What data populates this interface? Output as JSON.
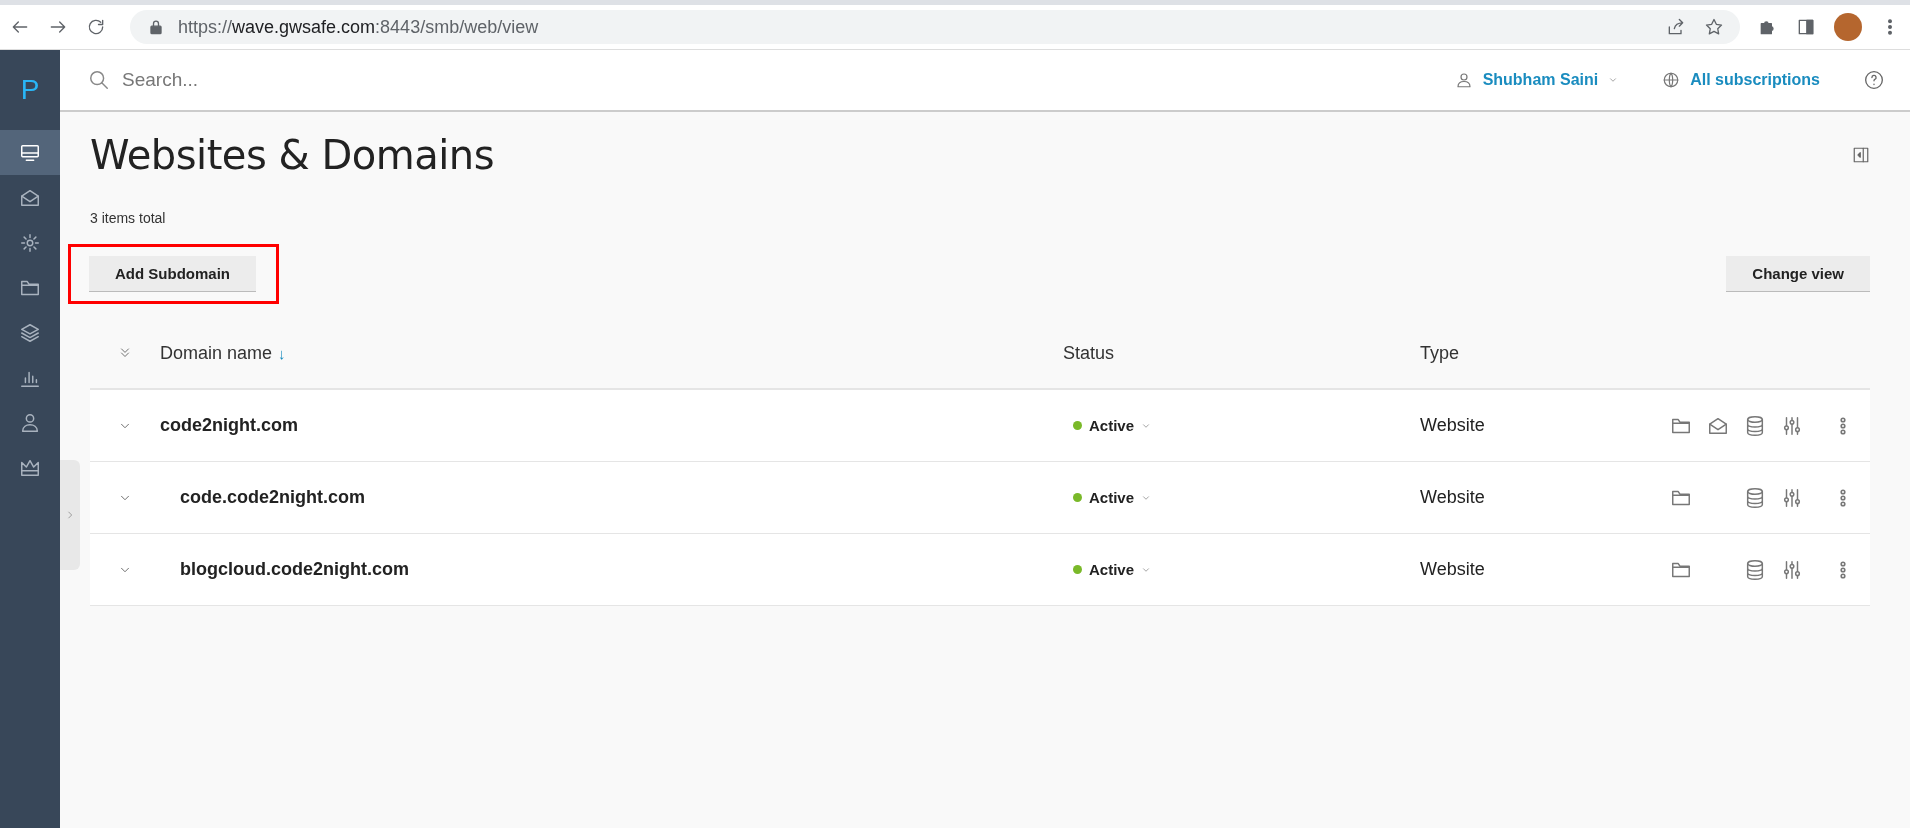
{
  "browser": {
    "url": {
      "scheme": "https://",
      "host": "wave.gwsafe.com",
      "path": ":8443/smb/web/view"
    }
  },
  "sidebar": {
    "logo": "P",
    "items": [
      {
        "kind": "monitor",
        "selected": true
      },
      {
        "kind": "mail",
        "selected": false
      },
      {
        "kind": "gear",
        "selected": false
      },
      {
        "kind": "folder",
        "selected": false
      },
      {
        "kind": "layers",
        "selected": false
      },
      {
        "kind": "chart",
        "selected": false
      },
      {
        "kind": "user",
        "selected": false
      },
      {
        "kind": "crown",
        "selected": false
      }
    ]
  },
  "header": {
    "search": {
      "placeholder": "Search..."
    },
    "user": "Shubham Saini",
    "subscriptions": "All subscriptions"
  },
  "page": {
    "title": "Websites & Domains",
    "count": "3 items total",
    "add_button": {
      "label": "Add Subdomain",
      "highlighted": true
    },
    "view_button": "Change view"
  },
  "table": {
    "columns": [
      "Domain name",
      "Status",
      "Type"
    ],
    "sort_mark": "↓",
    "rows": [
      {
        "name": "code2night.com",
        "status": "Active",
        "color": "#7ab929",
        "type": "Website",
        "icons": [
          {
            "kind": "folder"
          },
          {
            "kind": "mail"
          },
          {
            "kind": "database"
          },
          {
            "kind": "sliders"
          }
        ],
        "children": [
          {
            "name": "code.code2night.com",
            "status": "Active",
            "color": "#7ab929",
            "type": "Website",
            "icons": [
              {
                "kind": "folder"
              },
              {
                "kind": "database"
              },
              {
                "kind": "sliders"
              }
            ]
          },
          {
            "name": "blogcloud.code2night.com",
            "status": "Active",
            "color": "#7ab929",
            "type": "Website",
            "icons": [
              {
                "kind": "folder"
              },
              {
                "kind": "database"
              },
              {
                "kind": "sliders"
              }
            ]
          }
        ]
      }
    ]
  }
}
